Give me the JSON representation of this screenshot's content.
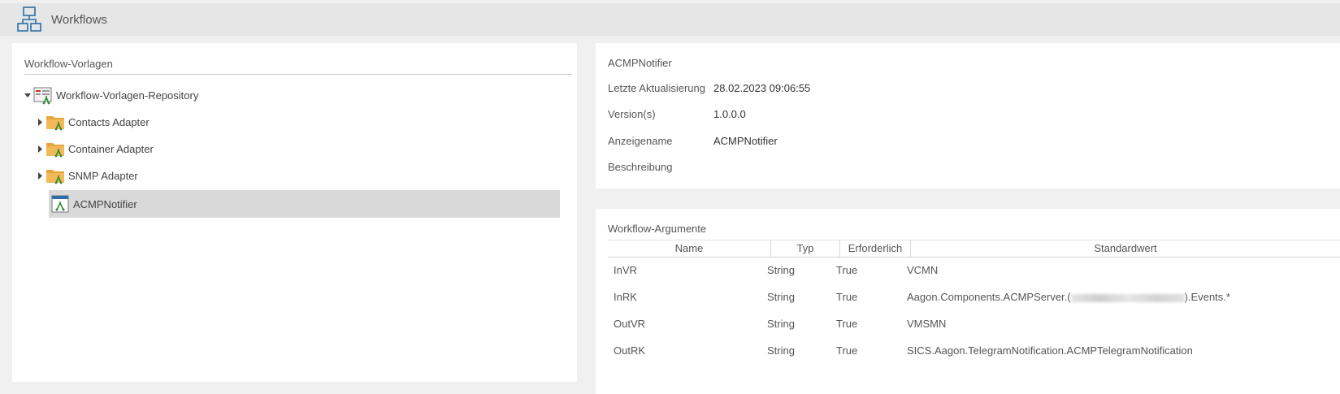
{
  "app": {
    "title": "Workflows",
    "icon": "workflow-icon"
  },
  "left_panel": {
    "title": "Workflow-Vorlagen",
    "tree": [
      {
        "label": "Workflow-Vorlagen-Repository",
        "icon": "repository-icon",
        "expanded": true
      },
      {
        "label": "Contacts Adapter",
        "icon": "folder-workflow-icon",
        "expanded": false
      },
      {
        "label": "Container Adapter",
        "icon": "folder-workflow-icon",
        "expanded": false
      },
      {
        "label": "SNMP Adapter",
        "icon": "folder-workflow-icon",
        "expanded": false
      },
      {
        "label": "ACMPNotifier",
        "icon": "workflow-file-icon",
        "selected": true
      }
    ]
  },
  "details": {
    "title": "ACMPNotifier",
    "properties": [
      {
        "label": "Letzte Aktualisierung",
        "value": "28.02.2023 09:06:55"
      },
      {
        "label": "Version(s)",
        "value": "1.0.0.0"
      },
      {
        "label": "Anzeigename",
        "value": "ACMPNotifier"
      },
      {
        "label": "Beschreibung",
        "value": ""
      }
    ]
  },
  "arguments": {
    "title": "Workflow-Argumente",
    "columns": [
      "Name",
      "Typ",
      "Erforderlich",
      "Standardwert"
    ],
    "rows": [
      {
        "name": "InVR",
        "type": "String",
        "required": "True",
        "default_prefix": "VCMN",
        "default_suffix": ""
      },
      {
        "name": "InRK",
        "type": "String",
        "required": "True",
        "default_prefix": "Aagon.Components.ACMPServer.(",
        "default_suffix": ").Events.*"
      },
      {
        "name": "OutVR",
        "type": "String",
        "required": "True",
        "default_prefix": "VMSMN",
        "default_suffix": ""
      },
      {
        "name": "OutRK",
        "type": "String",
        "required": "True",
        "default_prefix": "SICS.Aagon.TelegramNotification.ACMPTelegramNotification",
        "default_suffix": ""
      }
    ]
  },
  "colors": {
    "accent": "#2a6fa8",
    "folder": "#e8a33c",
    "workflow_green": "#2e8b3a",
    "selected_row": "#d9d9d9"
  }
}
